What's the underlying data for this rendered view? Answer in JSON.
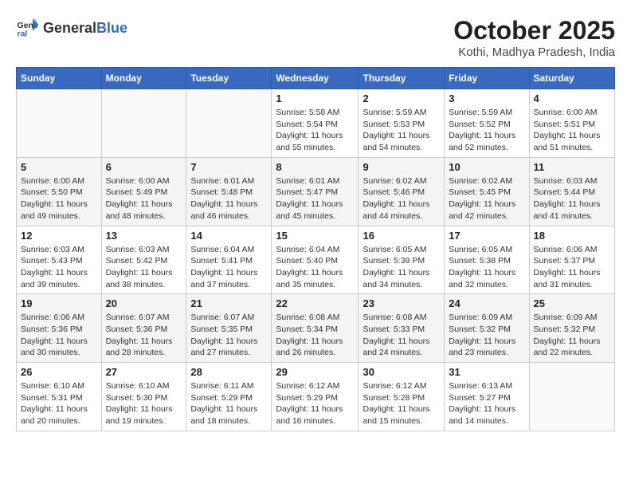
{
  "header": {
    "logo_general": "General",
    "logo_blue": "Blue",
    "month_title": "October 2025",
    "location": "Kothi, Madhya Pradesh, India"
  },
  "weekdays": [
    "Sunday",
    "Monday",
    "Tuesday",
    "Wednesday",
    "Thursday",
    "Friday",
    "Saturday"
  ],
  "weeks": [
    [
      {
        "day": "",
        "info": ""
      },
      {
        "day": "",
        "info": ""
      },
      {
        "day": "",
        "info": ""
      },
      {
        "day": "1",
        "info": "Sunrise: 5:58 AM\nSunset: 5:54 PM\nDaylight: 11 hours and 55 minutes."
      },
      {
        "day": "2",
        "info": "Sunrise: 5:59 AM\nSunset: 5:53 PM\nDaylight: 11 hours and 54 minutes."
      },
      {
        "day": "3",
        "info": "Sunrise: 5:59 AM\nSunset: 5:52 PM\nDaylight: 11 hours and 52 minutes."
      },
      {
        "day": "4",
        "info": "Sunrise: 6:00 AM\nSunset: 5:51 PM\nDaylight: 11 hours and 51 minutes."
      }
    ],
    [
      {
        "day": "5",
        "info": "Sunrise: 6:00 AM\nSunset: 5:50 PM\nDaylight: 11 hours and 49 minutes."
      },
      {
        "day": "6",
        "info": "Sunrise: 6:00 AM\nSunset: 5:49 PM\nDaylight: 11 hours and 48 minutes."
      },
      {
        "day": "7",
        "info": "Sunrise: 6:01 AM\nSunset: 5:48 PM\nDaylight: 11 hours and 46 minutes."
      },
      {
        "day": "8",
        "info": "Sunrise: 6:01 AM\nSunset: 5:47 PM\nDaylight: 11 hours and 45 minutes."
      },
      {
        "day": "9",
        "info": "Sunrise: 6:02 AM\nSunset: 5:46 PM\nDaylight: 11 hours and 44 minutes."
      },
      {
        "day": "10",
        "info": "Sunrise: 6:02 AM\nSunset: 5:45 PM\nDaylight: 11 hours and 42 minutes."
      },
      {
        "day": "11",
        "info": "Sunrise: 6:03 AM\nSunset: 5:44 PM\nDaylight: 11 hours and 41 minutes."
      }
    ],
    [
      {
        "day": "12",
        "info": "Sunrise: 6:03 AM\nSunset: 5:43 PM\nDaylight: 11 hours and 39 minutes."
      },
      {
        "day": "13",
        "info": "Sunrise: 6:03 AM\nSunset: 5:42 PM\nDaylight: 11 hours and 38 minutes."
      },
      {
        "day": "14",
        "info": "Sunrise: 6:04 AM\nSunset: 5:41 PM\nDaylight: 11 hours and 37 minutes."
      },
      {
        "day": "15",
        "info": "Sunrise: 6:04 AM\nSunset: 5:40 PM\nDaylight: 11 hours and 35 minutes."
      },
      {
        "day": "16",
        "info": "Sunrise: 6:05 AM\nSunset: 5:39 PM\nDaylight: 11 hours and 34 minutes."
      },
      {
        "day": "17",
        "info": "Sunrise: 6:05 AM\nSunset: 5:38 PM\nDaylight: 11 hours and 32 minutes."
      },
      {
        "day": "18",
        "info": "Sunrise: 6:06 AM\nSunset: 5:37 PM\nDaylight: 11 hours and 31 minutes."
      }
    ],
    [
      {
        "day": "19",
        "info": "Sunrise: 6:06 AM\nSunset: 5:36 PM\nDaylight: 11 hours and 30 minutes."
      },
      {
        "day": "20",
        "info": "Sunrise: 6:07 AM\nSunset: 5:36 PM\nDaylight: 11 hours and 28 minutes."
      },
      {
        "day": "21",
        "info": "Sunrise: 6:07 AM\nSunset: 5:35 PM\nDaylight: 11 hours and 27 minutes."
      },
      {
        "day": "22",
        "info": "Sunrise: 6:08 AM\nSunset: 5:34 PM\nDaylight: 11 hours and 26 minutes."
      },
      {
        "day": "23",
        "info": "Sunrise: 6:08 AM\nSunset: 5:33 PM\nDaylight: 11 hours and 24 minutes."
      },
      {
        "day": "24",
        "info": "Sunrise: 6:09 AM\nSunset: 5:32 PM\nDaylight: 11 hours and 23 minutes."
      },
      {
        "day": "25",
        "info": "Sunrise: 6:09 AM\nSunset: 5:32 PM\nDaylight: 11 hours and 22 minutes."
      }
    ],
    [
      {
        "day": "26",
        "info": "Sunrise: 6:10 AM\nSunset: 5:31 PM\nDaylight: 11 hours and 20 minutes."
      },
      {
        "day": "27",
        "info": "Sunrise: 6:10 AM\nSunset: 5:30 PM\nDaylight: 11 hours and 19 minutes."
      },
      {
        "day": "28",
        "info": "Sunrise: 6:11 AM\nSunset: 5:29 PM\nDaylight: 11 hours and 18 minutes."
      },
      {
        "day": "29",
        "info": "Sunrise: 6:12 AM\nSunset: 5:29 PM\nDaylight: 11 hours and 16 minutes."
      },
      {
        "day": "30",
        "info": "Sunrise: 6:12 AM\nSunset: 5:28 PM\nDaylight: 11 hours and 15 minutes."
      },
      {
        "day": "31",
        "info": "Sunrise: 6:13 AM\nSunset: 5:27 PM\nDaylight: 11 hours and 14 minutes."
      },
      {
        "day": "",
        "info": ""
      }
    ]
  ]
}
